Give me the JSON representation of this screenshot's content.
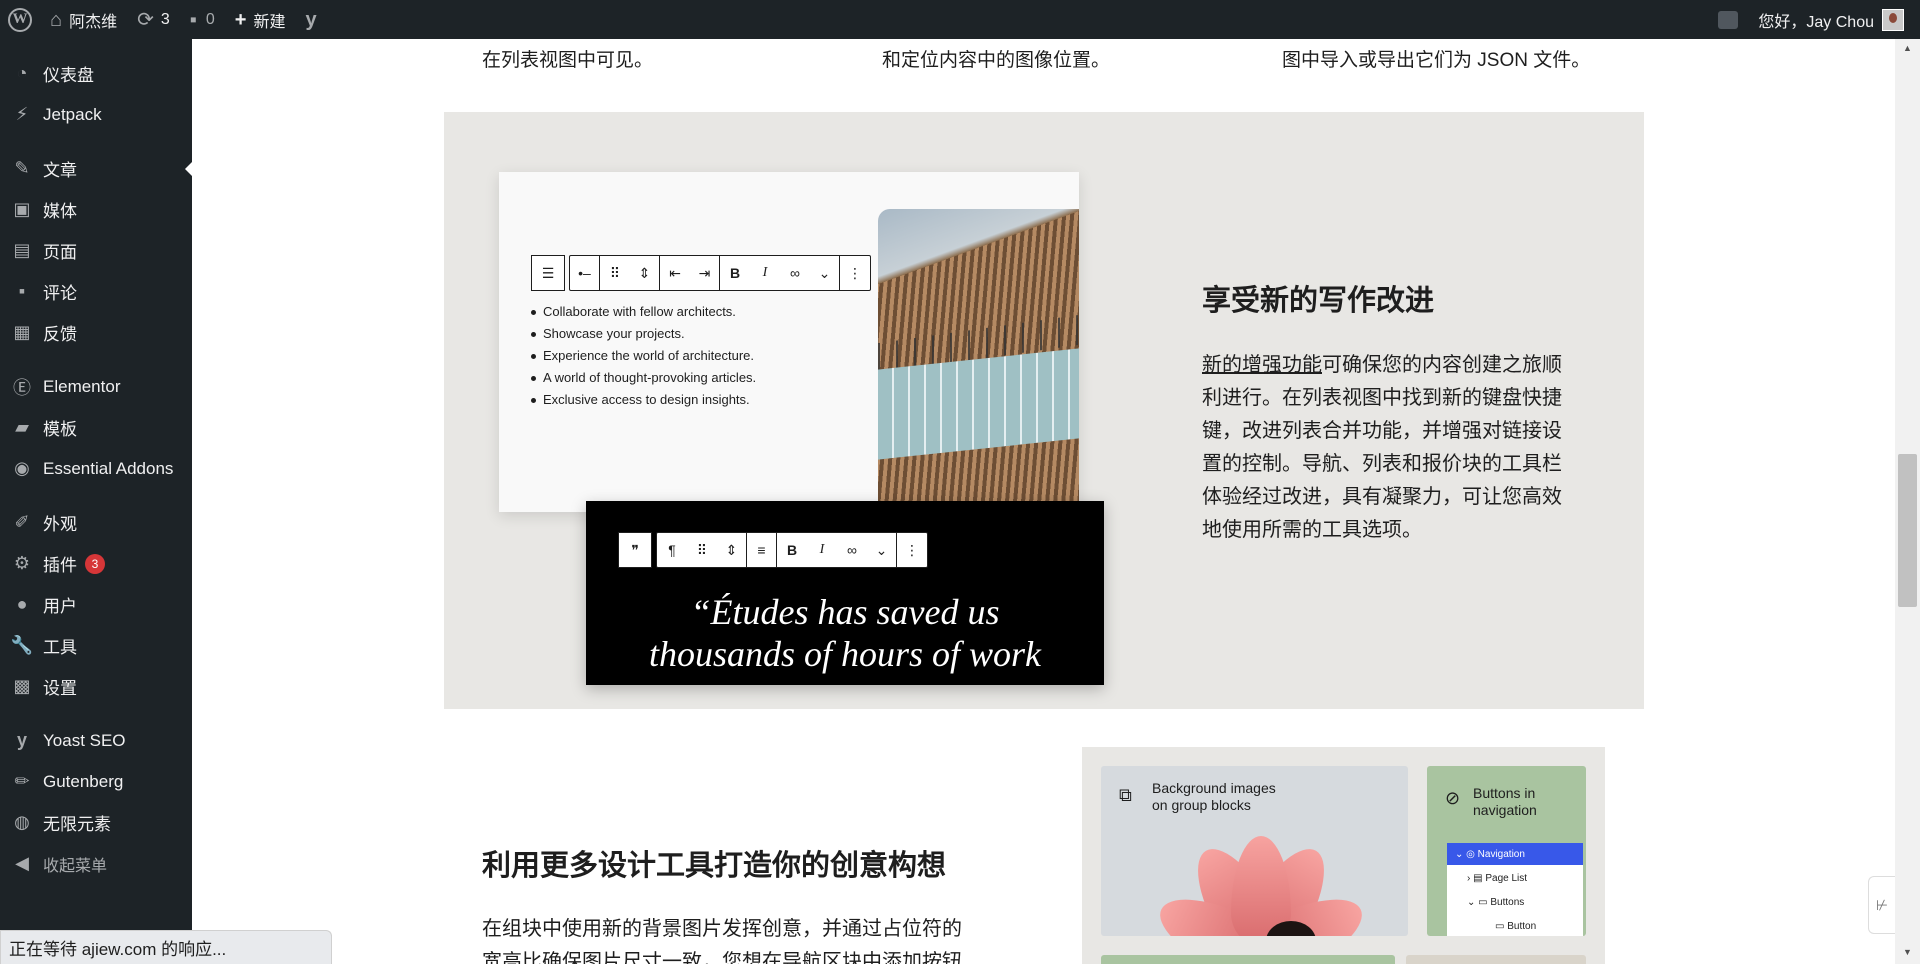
{
  "adminbar": {
    "site_name": "阿杰维",
    "updates_count": "3",
    "comments_count": "0",
    "new_label": "新建",
    "greeting": "您好，Jay Chou"
  },
  "sidebar": {
    "items": [
      {
        "label": "仪表盘",
        "icon": "dashboard-icon"
      },
      {
        "label": "Jetpack",
        "icon": "jetpack-icon"
      },
      {
        "label": "文章",
        "icon": "pin-icon"
      },
      {
        "label": "媒体",
        "icon": "media-icon"
      },
      {
        "label": "页面",
        "icon": "page-icon"
      },
      {
        "label": "评论",
        "icon": "comment-icon"
      },
      {
        "label": "反馈",
        "icon": "feedback-icon"
      },
      {
        "label": "Elementor",
        "icon": "elementor-icon"
      },
      {
        "label": "模板",
        "icon": "folder-icon"
      },
      {
        "label": "Essential Addons",
        "icon": "essential-addons-icon"
      },
      {
        "label": "外观",
        "icon": "brush-icon"
      },
      {
        "label": "插件",
        "icon": "plugin-icon",
        "badge": "3"
      },
      {
        "label": "用户",
        "icon": "user-icon"
      },
      {
        "label": "工具",
        "icon": "wrench-icon"
      },
      {
        "label": "设置",
        "icon": "settings-icon"
      },
      {
        "label": "Yoast SEO",
        "icon": "yoast-icon"
      },
      {
        "label": "Gutenberg",
        "icon": "pencil-icon"
      },
      {
        "label": "无限元素",
        "icon": "unlimited-elements-icon"
      }
    ],
    "collapse_label": "收起菜单"
  },
  "content": {
    "top_texts": [
      "在列表视图中可见。",
      "和定位内容中的图像位置。",
      "图中导入或导出它们为 JSON 文件。"
    ],
    "list_items": [
      "Collaborate with fellow architects.",
      "Showcase your projects.",
      "Experience the world of architecture.",
      "A world of thought-provoking articles.",
      "Exclusive access to design insights."
    ],
    "quote_line1": "“Études has saved us",
    "quote_line2": "thousands of hours of work",
    "writing_title": "享受新的写作改进",
    "writing_link": "新的增强功能",
    "writing_para_lines": [
      "可确保您的内容创建之旅顺",
      "利进行。在列表视图中找到新的键盘快捷",
      "键，改进列表合并功能，并增强对链接设",
      "置的控制。导航、列表和报价块的工具栏",
      "体验经过改进，具有凝聚力，可让您高效",
      "地使用所需的工具选项。"
    ],
    "design_title": "利用更多设计工具打造你的创意构想",
    "design_para_line1": "在组块中使用新的背景图片发挥创意，并通过占位符的",
    "design_para_line2": "宽高比确保图片尺寸一致，您想在导航区块中添加按钮",
    "tile_bg_line1": "Background images",
    "tile_bg_line2": "on group blocks",
    "tile_nav_line1": "Buttons in",
    "tile_nav_line2": "navigation",
    "nav_rows": [
      "Navigation",
      "Page List",
      "Buttons",
      "Button"
    ]
  },
  "status": {
    "text": "正在等待 ajiew.com 的响应..."
  },
  "colors": {
    "admin_dark": "#1d2327",
    "badge_red": "#d63638",
    "section_gray": "#e8e7e4",
    "nav_blue": "#3858e9",
    "tile_green": "#a9c4a0"
  }
}
